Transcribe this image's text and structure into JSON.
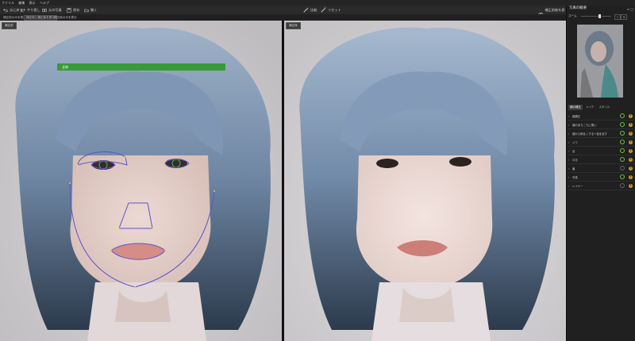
{
  "menu": [
    "ファイル",
    "編集",
    "表示",
    "ヘルプ"
  ],
  "toolbar": {
    "undo": "元に戻す",
    "redo": "やり直し",
    "before_after": "元の写真",
    "save": "保存",
    "open": "開く",
    "compare": "比較",
    "reset": "リセット",
    "show_all": "補正前後を表示"
  },
  "subbar": {
    "tab1": "補正前のみを表示",
    "tab2": "補正前と補正後を表示",
    "tab3": "補正後のみを表示"
  },
  "left_view": {
    "label": "補正前",
    "banner": "全体"
  },
  "right_view": {
    "label": "補正後"
  },
  "sidebar": {
    "title": "写真の概要",
    "options": "≡ □",
    "zoom_label": "ズーム",
    "tabs": [
      "顔の補正",
      "メイク",
      "スタイル"
    ],
    "adjustments": [
      {
        "label": "顔補正",
        "active": true
      },
      {
        "label": "顔のあちこちに黒い",
        "active": true
      },
      {
        "label": "顔から明るくするへ色を足す",
        "active": true
      },
      {
        "label": "シワ",
        "active": true
      },
      {
        "label": "目",
        "active": true
      },
      {
        "label": "口元",
        "active": true
      },
      {
        "label": "眉",
        "active": false
      },
      {
        "label": "写真",
        "active": true
      },
      {
        "label": "レイヤー",
        "active": false
      }
    ]
  },
  "colors": {
    "accent_green": "#3a9a3a",
    "landmark_line": "#5a55cc",
    "background": "#1c1c1c"
  }
}
